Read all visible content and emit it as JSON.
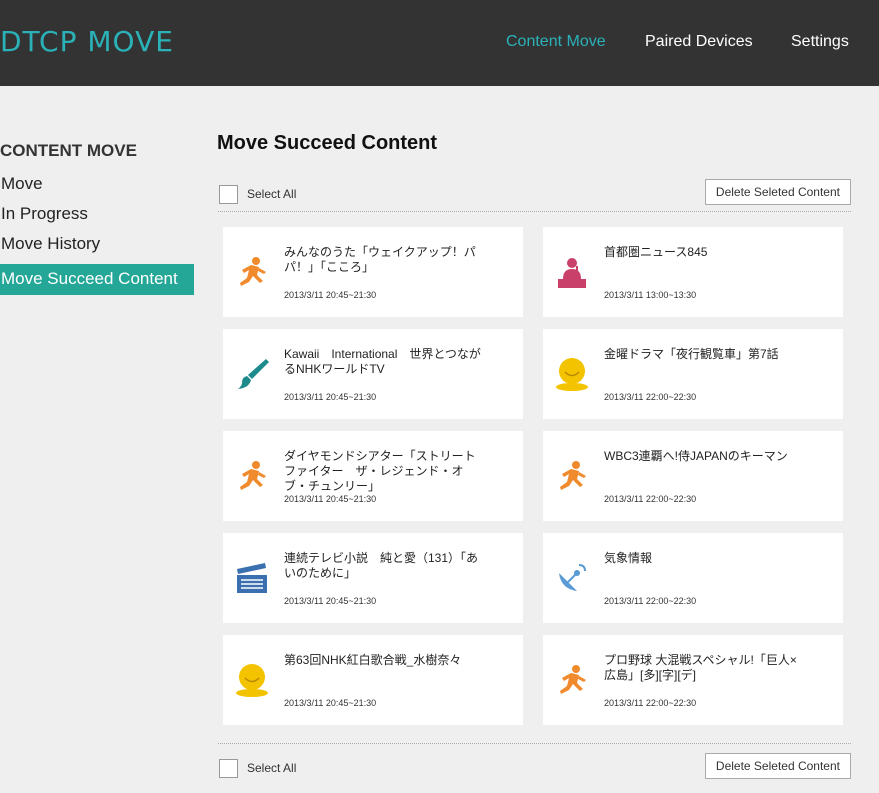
{
  "header": {
    "logo": "DTCP MOVE",
    "nav": [
      "Content Move",
      "Paired Devices",
      "Settings"
    ]
  },
  "sidebar": {
    "title": "CONTENT MOVE",
    "items": [
      "Move",
      "In Progress",
      "Move History",
      "Move Succeed Content"
    ]
  },
  "main": {
    "title": "Move Succeed Content",
    "select_all": "Select All",
    "delete_button": "Delete Seleted Content",
    "cards": [
      {
        "title": "みんなのうた「ウェイクアップ！パパ！」「こころ」",
        "time": "2013/3/11 20:45~21:30",
        "icon": "running-person-icon"
      },
      {
        "title": "首都圏ニュース845",
        "time": "2013/3/11 13:00~13:30",
        "icon": "news-anchor-icon"
      },
      {
        "title": "Kawaii　International　世界とつながるNHKワールドTV",
        "time": "2013/3/11 20:45~21:30",
        "icon": "paintbrush-icon"
      },
      {
        "title": "金曜ドラマ「夜行観覧車」第7話",
        "time": "2013/3/11 22:00~22:30",
        "icon": "smiley-icon"
      },
      {
        "title": "ダイヤモンドシアター「ストリートファイター　ザ・レジェンド・オブ・チュンリー」",
        "time": "2013/3/11 20:45~21:30",
        "icon": "running-person-icon"
      },
      {
        "title": "WBC3連覇へ!侍JAPANのキーマン",
        "time": "2013/3/11 22:00~22:30",
        "icon": "running-person-icon"
      },
      {
        "title": "連続テレビ小説　純と愛（131）「あいのために」",
        "time": "2013/3/11 20:45~21:30",
        "icon": "clapperboard-icon"
      },
      {
        "title": "気象情報",
        "time": "2013/3/11 22:00~22:30",
        "icon": "satellite-dish-icon"
      },
      {
        "title": "第63回NHK紅白歌合戦_水樹奈々",
        "time": "2013/3/11 20:45~21:30",
        "icon": "smiley-icon"
      },
      {
        "title": "プロ野球 大混戦スペシャル!「巨人×広島」[多][字][デ]",
        "time": "2013/3/11 22:00~22:30",
        "icon": "running-person-icon"
      }
    ]
  },
  "colors": {
    "accent": "#2ab2b8",
    "active_bg": "#24a797",
    "header_bg": "#333333",
    "runner": "#f08a2c",
    "anchor": "#c9406a",
    "brush": "#1d8a8c",
    "smiley": "#f3c300",
    "clapper": "#3a6fb0",
    "dish": "#5a9bd6"
  }
}
